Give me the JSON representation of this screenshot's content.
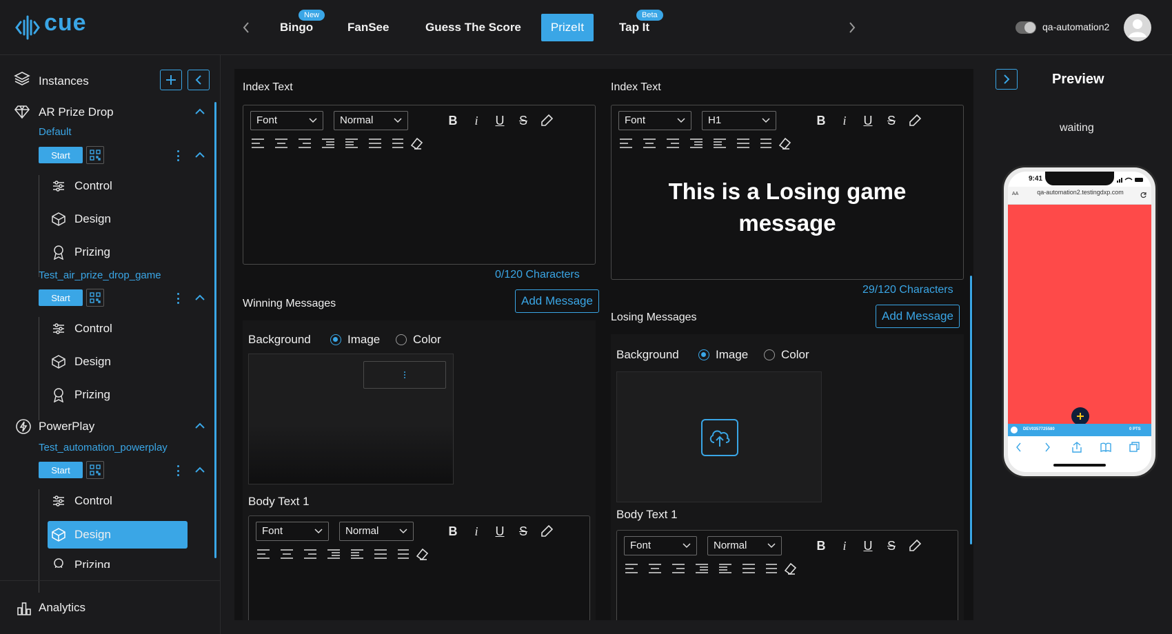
{
  "brand": {
    "name": "cue",
    "accent": "#3aa6e6"
  },
  "topnav": {
    "tabs": [
      {
        "label": "Bingo",
        "badge": "New"
      },
      {
        "label": "FanSee"
      },
      {
        "label": "Guess The Score"
      },
      {
        "label": "PrizeIt",
        "active": true
      },
      {
        "label": "Tap It",
        "badge": "Beta"
      }
    ],
    "username": "qa-automation2"
  },
  "sidebar": {
    "instances_label": "Instances",
    "groups": [
      {
        "title": "AR Prize Drop",
        "instances": [
          {
            "name": "Default",
            "start_label": "Start",
            "items": [
              "Control",
              "Design",
              "Prizing"
            ]
          },
          {
            "name": "Test_air_prize_drop_game",
            "start_label": "Start",
            "items": [
              "Control",
              "Design",
              "Prizing"
            ]
          }
        ]
      },
      {
        "title": "PowerPlay",
        "instances": [
          {
            "name": "Test_automation_powerplay",
            "start_label": "Start",
            "items": [
              "Control",
              "Design",
              "Prizing"
            ],
            "active_item": "Design"
          }
        ]
      }
    ],
    "analytics_label": "Analytics"
  },
  "main": {
    "left": {
      "index_label": "Index Text",
      "font_value": "Font",
      "size_value": "Normal",
      "counter": "0/120 Characters",
      "messages_label": "Winning Messages",
      "add_label": "Add Message",
      "background_label": "Background",
      "image_label": "Image",
      "color_label": "Color",
      "body_label": "Body Text 1",
      "body_font": "Font",
      "body_size": "Normal"
    },
    "right": {
      "index_label": "Index Text",
      "font_value": "Font",
      "size_value": "H1",
      "content": "This is a Losing game message",
      "counter": "29/120 Characters",
      "messages_label": "Losing Messages",
      "add_label": "Add Message",
      "background_label": "Background",
      "image_label": "Image",
      "color_label": "Color",
      "body_label": "Body Text 1",
      "body_font": "Font",
      "body_size": "Normal"
    }
  },
  "preview": {
    "title": "Preview",
    "status": "waiting",
    "phone_time": "9:41",
    "phone_url": "qa-automation2.testingdxp.com",
    "phone_aa": "AA",
    "screen_color": "#fe4a49",
    "phone_bar_left": "DEV0357725580",
    "phone_bar_right": "0 PTS"
  },
  "tools": {
    "bold": "B",
    "italic": "i",
    "underline": "U",
    "strike": "S"
  }
}
